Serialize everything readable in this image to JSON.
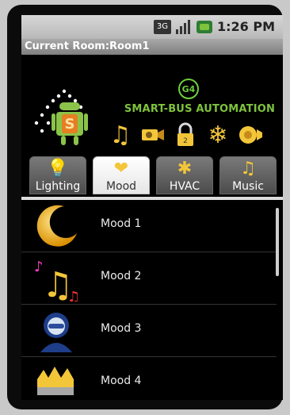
{
  "status_bar": {
    "network": "3G",
    "time": "1:26 PM"
  },
  "title_bar": {
    "title": "Current Room:Room1"
  },
  "header": {
    "badge": "G4",
    "brand_text": "SMART-BUS AUTOMATION",
    "icons": [
      "music-note-icon",
      "camera-icon",
      "lock-icon",
      "snowflake-icon",
      "speaker-icon"
    ]
  },
  "tabs": [
    {
      "label": "Lighting",
      "icon": "lightbulb-icon",
      "active": false
    },
    {
      "label": "Mood",
      "icon": "heart-icon",
      "active": true
    },
    {
      "label": "HVAC",
      "icon": "fan-icon",
      "active": false
    },
    {
      "label": "Music",
      "icon": "music-note-icon",
      "active": false
    }
  ],
  "mood_list": [
    {
      "label": "Mood 1",
      "icon": "crescent-moon-icon"
    },
    {
      "label": "Mood 2",
      "icon": "music-notes-icon"
    },
    {
      "label": "Mood 3",
      "icon": "user-face-icon"
    },
    {
      "label": "Mood 4",
      "icon": "crown-icon"
    }
  ]
}
